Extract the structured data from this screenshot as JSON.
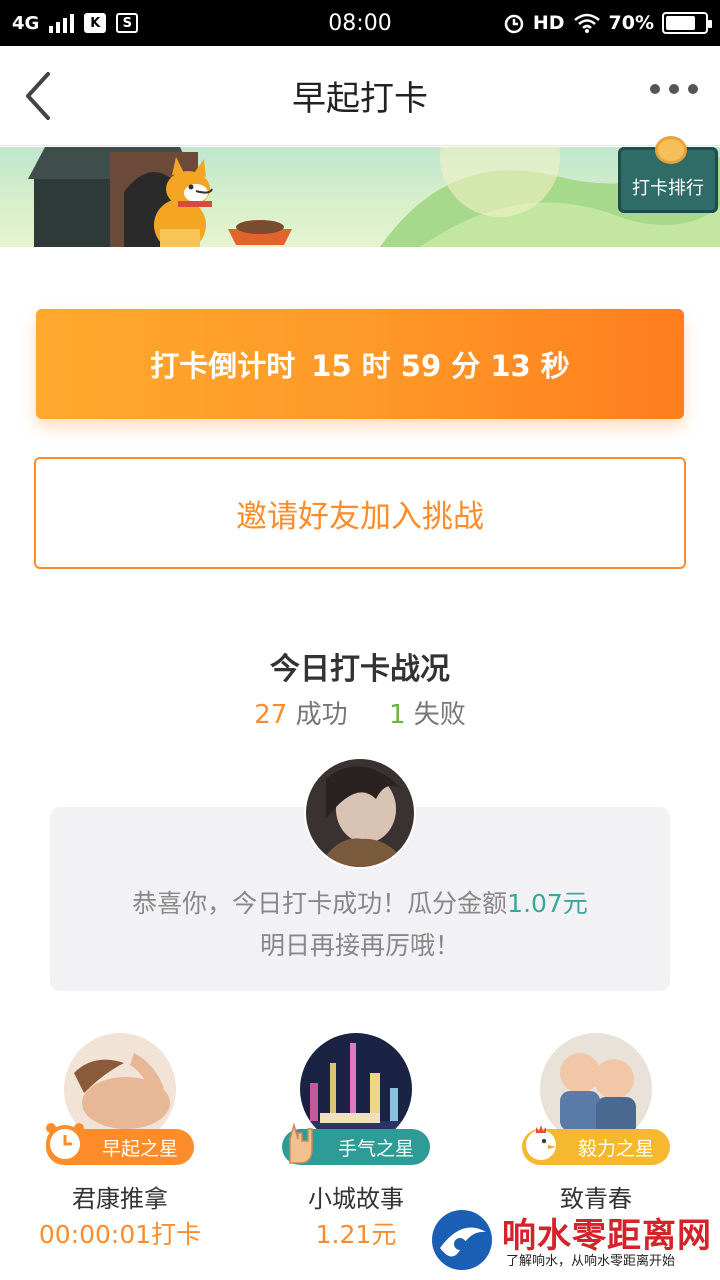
{
  "status_bar": {
    "network": "4G",
    "time": "08:00",
    "hd": "HD",
    "battery": "70%",
    "app_icon_1": "K",
    "app_icon_2": "S"
  },
  "header": {
    "title": "早起打卡",
    "back_icon": "chevron-left-icon",
    "more_icon": "more-dots-icon"
  },
  "banner": {
    "rank_label": "打卡排行"
  },
  "countdown": {
    "label": "打卡倒计时",
    "time": "15 时 59 分 13 秒"
  },
  "invite": {
    "label": "邀请好友加入挑战"
  },
  "stats": {
    "title": "今日打卡战况",
    "success_count": "27",
    "success_label": " 成功",
    "fail_count": "1",
    "fail_label": " 失败"
  },
  "result": {
    "line1_prefix": "恭喜你，今日打卡成功！瓜分金额",
    "amount": "1.07元",
    "line2": "明日再接再厉哦！"
  },
  "stars": [
    {
      "badge": "早起之星",
      "name": "君康推拿",
      "value": "00:00:01打卡",
      "color": "#ff8c2b",
      "icon": "alarm-clock-icon"
    },
    {
      "badge": "手气之星",
      "name": "小城故事",
      "value": "1.21元",
      "color": "#2f9b97",
      "icon": "rock-hand-icon"
    },
    {
      "badge": "毅力之星",
      "name": "致青春",
      "value": "",
      "color": "#f5b82e",
      "icon": "chicken-icon"
    }
  ],
  "watermark": {
    "text": "响水零距离网",
    "sub": "了解响水，从响水零距离开始"
  },
  "colors": {
    "accent_orange": "#ff8c2b",
    "success_green": "#6bb53a",
    "teal": "#3aa6a0"
  }
}
